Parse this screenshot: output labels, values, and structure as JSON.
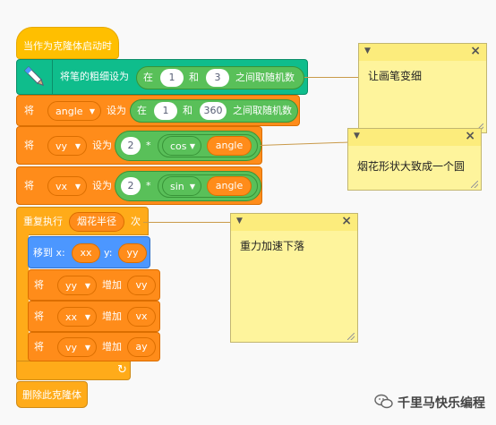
{
  "hat": {
    "label": "当作为克隆体启动时"
  },
  "pen_block": {
    "label": "将笔的粗细设为",
    "op": {
      "pre": "在",
      "mid": "和",
      "post": "之间取随机数",
      "a": "1",
      "b": "3"
    }
  },
  "angle_block": {
    "set": "将",
    "var": "angle",
    "to": "设为",
    "op": {
      "pre": "在",
      "mid": "和",
      "post": "之间取随机数",
      "a": "1",
      "b": "360"
    }
  },
  "vy_block": {
    "set": "将",
    "var": "vy",
    "to": "设为",
    "num": "2",
    "mult": "*",
    "fn": "cos",
    "arg": "angle"
  },
  "vx_block": {
    "set": "将",
    "var": "vx",
    "to": "设为",
    "num": "2",
    "mult": "*",
    "fn": "sin",
    "arg": "angle"
  },
  "repeat_block": {
    "label": "重复执行",
    "reporter": "烟花半径",
    "suffix": "次"
  },
  "move_block": {
    "label": "移到 x:",
    "x": "xx",
    "ylabel": "y:",
    "y": "yy"
  },
  "inc_blocks": [
    {
      "set": "将",
      "var": "yy",
      "by": "增加",
      "val": "vy"
    },
    {
      "set": "将",
      "var": "xx",
      "by": "增加",
      "val": "vx"
    },
    {
      "set": "将",
      "var": "vy",
      "by": "增加",
      "val": "ay"
    }
  ],
  "delete_block": {
    "label": "删除此克隆体"
  },
  "notes": [
    {
      "text": "让画笔变细"
    },
    {
      "text": "烟花形状大致成一个圆"
    },
    {
      "text": "重力加速下落"
    }
  ],
  "loop_arrow": "↻",
  "watermark": {
    "text": "千里马快乐编程"
  },
  "colors": {
    "events": "#ffbf00",
    "control": "#ffab19",
    "variables": "#ff8c1a",
    "pen": "#0fbd8c",
    "motion": "#4c97ff",
    "operators": "#59c059",
    "note": "#fef49c"
  }
}
